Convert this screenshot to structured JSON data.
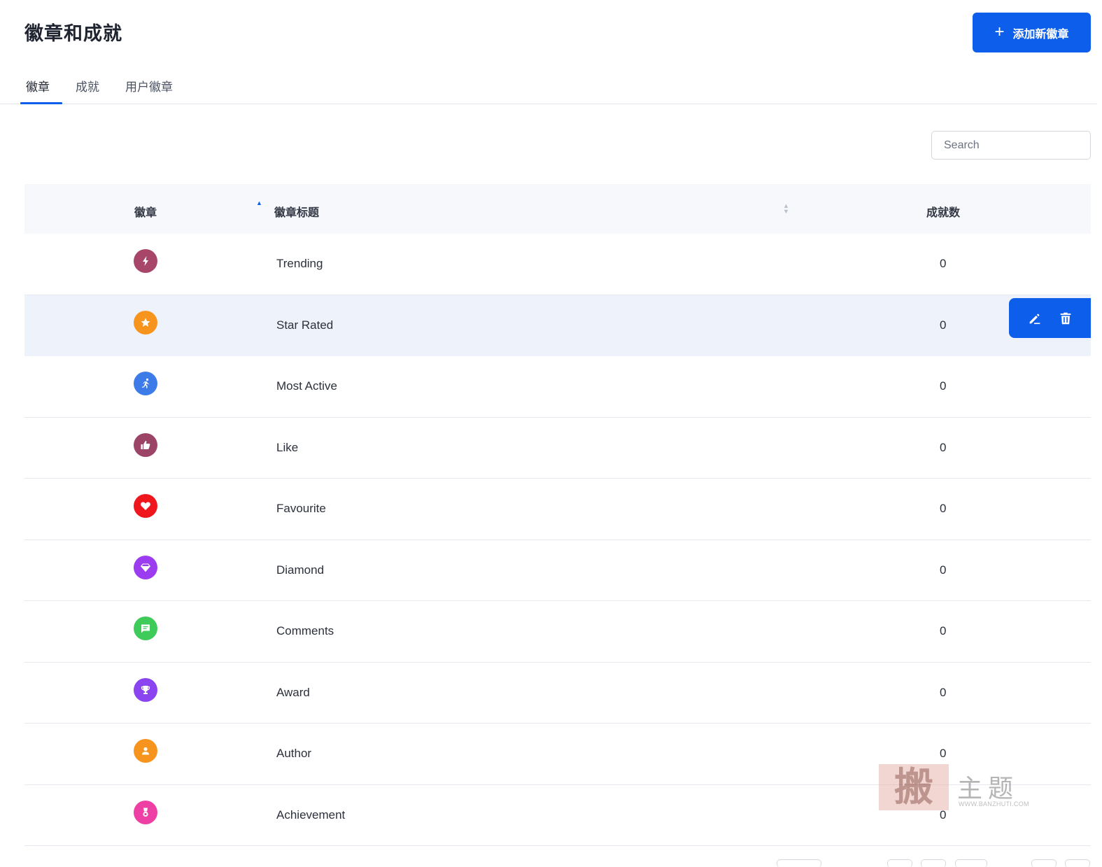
{
  "header": {
    "title": "徽章和成就",
    "add_button": "添加新徽章"
  },
  "tabs": [
    {
      "label": "徽章",
      "active": true
    },
    {
      "label": "成就",
      "active": false
    },
    {
      "label": "用户徽章",
      "active": false
    }
  ],
  "search": {
    "placeholder": "Search",
    "value": ""
  },
  "table": {
    "columns": {
      "badge": "徽章",
      "title": "徽章标题",
      "count": "成就数"
    },
    "rows": [
      {
        "icon": "bolt-icon",
        "color": "#a8466a",
        "title": "Trending",
        "count": "0"
      },
      {
        "icon": "star-icon",
        "color": "#f7941d",
        "title": "Star Rated",
        "count": "0"
      },
      {
        "icon": "running-icon",
        "color": "#3d7be8",
        "title": "Most Active",
        "count": "0"
      },
      {
        "icon": "thumbs-up-icon",
        "color": "#9b4466",
        "title": "Like",
        "count": "0"
      },
      {
        "icon": "heart-icon",
        "color": "#f0161e",
        "title": "Favourite",
        "count": "0"
      },
      {
        "icon": "diamond-icon",
        "color": "#9b3cf0",
        "title": "Diamond",
        "count": "0"
      },
      {
        "icon": "comment-icon",
        "color": "#3ecb5a",
        "title": "Comments",
        "count": "0"
      },
      {
        "icon": "trophy-icon",
        "color": "#8a44f0",
        "title": "Award",
        "count": "0"
      },
      {
        "icon": "user-icon",
        "color": "#f7941d",
        "title": "Author",
        "count": "0"
      },
      {
        "icon": "medal-icon",
        "color": "#ee3fa5",
        "title": "Achievement",
        "count": "0"
      }
    ]
  },
  "colors": {
    "primary": "#0d5eea",
    "header_bg": "#f6f8fc",
    "hover_row_bg": "#eef2fa",
    "border": "#e5e8ee"
  },
  "row_actions": {
    "edit_icon": "pencil-icon",
    "delete_icon": "trash-icon"
  },
  "watermark": {
    "stamp": "搬",
    "text": "主题",
    "url": "WWW.BANZHUTI.COM"
  }
}
